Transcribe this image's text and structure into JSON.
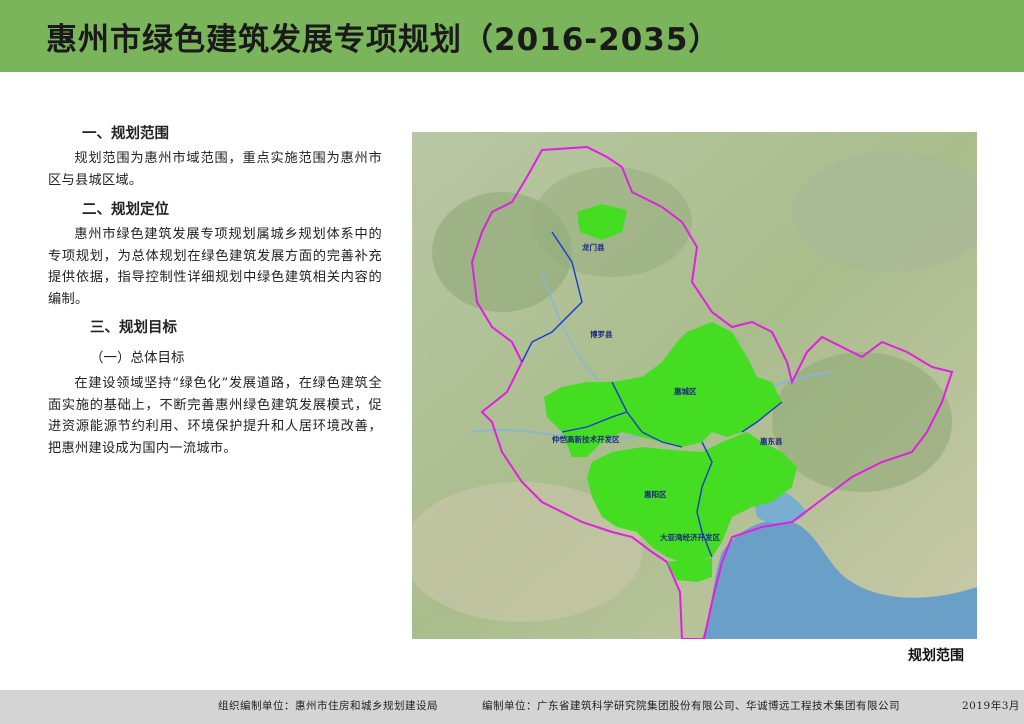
{
  "header": {
    "title": "惠州市绿色建筑发展专项规划（2016-2035）",
    "color": "#7ab55c"
  },
  "sections": {
    "scope_heading": "一、规划范围",
    "scope_text": "规划范围为惠州市域范围，重点实施范围为惠州市区与县城区域。",
    "position_heading": "二、规划定位",
    "position_text": "惠州市绿色建筑发展专项规划属城乡规划体系中的专项规划，为总体规划在绿色建筑发展方面的完善补充提供依据，指导控制性详细规划中绿色建筑相关内容的编制。",
    "goal_heading": "三、规划目标",
    "goal_subheading": "（一）总体目标",
    "goal_text": "在建设领域坚持“绿色化”发展道路，在绿色建筑全面实施的基础上，不断完善惠州绿色建筑发展模式，促进资源能源节约利用、环境保护提升和人居环境改善，把惠州建设成为国内一流城市。"
  },
  "map": {
    "caption": "规划范围",
    "labels": {
      "longmen": "龙门县",
      "boluo": "博罗县",
      "huicheng": "惠城区",
      "zhongkai": "仲恺高新技术开发区",
      "huiyang": "惠阳区",
      "huidong": "惠东县",
      "dayawan": "大亚湾经济开发区"
    },
    "colors": {
      "boundary": "#e020e0",
      "focus_area": "#44dd22",
      "district_line": "#1a3ad0"
    }
  },
  "footer": {
    "organizer": "组织编制单位：惠州市住房和城乡规划建设局",
    "compiler": "编制单位：广东省建筑科学研究院集团股份有限公司、华诚博远工程技术集团有限公司",
    "date": "2019年3月"
  }
}
